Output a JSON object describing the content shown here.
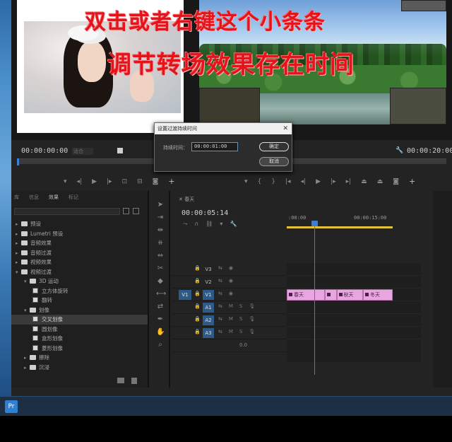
{
  "overlay": {
    "line1": "双击或者右键这个小条条",
    "line2": "调节转场效果存在时间"
  },
  "source_monitor": {
    "timecode": "00:00:00:00",
    "fit_label": "适合"
  },
  "program_monitor": {
    "timecode_end": "00:00:20:00"
  },
  "dialog": {
    "title": "设置过渡持续时间",
    "close": "✕",
    "duration_label": "持续时间：",
    "duration_value": "00:00:01:00",
    "ok_label": "确定",
    "cancel_label": "取消"
  },
  "effects_panel": {
    "tabs": [
      "库",
      "信息",
      "效果",
      "标记"
    ],
    "active_tab": "效果",
    "tree": [
      {
        "label": "预设",
        "level": 0,
        "type": "folder",
        "expanded": false
      },
      {
        "label": "Lumetri 预设",
        "level": 0,
        "type": "folder",
        "expanded": false
      },
      {
        "label": "音频效果",
        "level": 0,
        "type": "folder",
        "expanded": false
      },
      {
        "label": "音频过渡",
        "level": 0,
        "type": "folder",
        "expanded": false
      },
      {
        "label": "视频效果",
        "level": 0,
        "type": "folder",
        "expanded": false
      },
      {
        "label": "视频过渡",
        "level": 0,
        "type": "folder",
        "expanded": true
      },
      {
        "label": "3D 运动",
        "level": 1,
        "type": "folder",
        "expanded": true
      },
      {
        "label": "立方体旋转",
        "level": 2,
        "type": "effect"
      },
      {
        "label": "翻转",
        "level": 2,
        "type": "effect"
      },
      {
        "label": "划像",
        "level": 1,
        "type": "folder",
        "expanded": true
      },
      {
        "label": "交叉划像",
        "level": 2,
        "type": "effect",
        "selected": true
      },
      {
        "label": "圆划像",
        "level": 2,
        "type": "effect"
      },
      {
        "label": "盒形划像",
        "level": 2,
        "type": "effect"
      },
      {
        "label": "菱形划像",
        "level": 2,
        "type": "effect"
      },
      {
        "label": "擦除",
        "level": 1,
        "type": "folder",
        "expanded": false
      },
      {
        "label": "沉浸",
        "level": 1,
        "type": "folder",
        "expanded": false
      }
    ]
  },
  "timeline": {
    "tab": "春天",
    "timecode": "00:00:05:14",
    "ruler": [
      ":00:00",
      "00:00:15:00"
    ],
    "tracks": [
      {
        "name": "V3",
        "kind": "video",
        "targeted": false,
        "source": ""
      },
      {
        "name": "V2",
        "kind": "video",
        "targeted": false,
        "source": ""
      },
      {
        "name": "V1",
        "kind": "video",
        "targeted": true,
        "source": "V1"
      },
      {
        "name": "A1",
        "kind": "audio",
        "targeted": true,
        "source": ""
      },
      {
        "name": "A2",
        "kind": "audio",
        "targeted": true,
        "source": ""
      },
      {
        "name": "A3",
        "kind": "audio",
        "targeted": true,
        "source": ""
      }
    ],
    "master_value": "0.0",
    "clips": [
      {
        "label": "春天",
        "track": "V1",
        "start": 0.0,
        "end": 0.36
      },
      {
        "label": "",
        "track": "V1",
        "start": 0.36,
        "end": 0.47
      },
      {
        "label": "秋天",
        "track": "V1",
        "start": 0.47,
        "end": 0.72
      },
      {
        "label": "冬天",
        "track": "V1",
        "start": 0.72,
        "end": 1.0
      }
    ]
  },
  "taskbar": {
    "app_icon": "Pr"
  }
}
